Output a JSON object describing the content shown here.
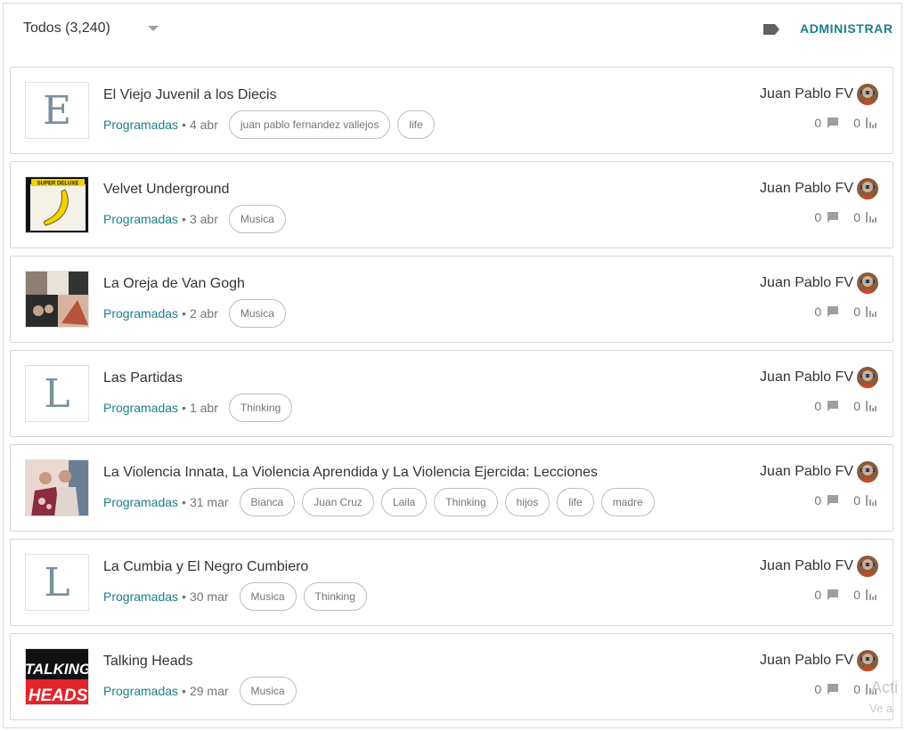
{
  "header": {
    "filter_label": "Todos (3,240)",
    "manage_label": "ADMINISTRAR",
    "label_icon": "label-tag-icon"
  },
  "posts": [
    {
      "title": "El Viejo Juvenil a los Diecis",
      "status": "Programadas",
      "date": "4 abr",
      "tags": [
        "juan pablo fernandez vallejos",
        "life"
      ],
      "author": "Juan Pablo FV",
      "comments": "0",
      "views": "0",
      "thumb_letter": "E"
    },
    {
      "title": "Velvet Underground",
      "status": "Programadas",
      "date": "3 abr",
      "tags": [
        "Musica"
      ],
      "author": "Juan Pablo FV",
      "comments": "0",
      "views": "0",
      "thumb_letter": "",
      "thumb_caption": "SUPER DELUXE"
    },
    {
      "title": "La Oreja de Van Gogh",
      "status": "Programadas",
      "date": "2 abr",
      "tags": [
        "Musica"
      ],
      "author": "Juan Pablo FV",
      "comments": "0",
      "views": "0",
      "thumb_letter": ""
    },
    {
      "title": "Las Partidas",
      "status": "Programadas",
      "date": "1 abr",
      "tags": [
        "Thinking"
      ],
      "author": "Juan Pablo FV",
      "comments": "0",
      "views": "0",
      "thumb_letter": "L"
    },
    {
      "title": "La Violencia Innata, La Violencia Aprendida y La Violencia Ejercida: Lecciones",
      "status": "Programadas",
      "date": "31 mar",
      "tags": [
        "Bianca",
        "Juan Cruz",
        "Laila",
        "Thinking",
        "hijos",
        "life",
        "madre"
      ],
      "author": "Juan Pablo FV",
      "comments": "0",
      "views": "0",
      "thumb_letter": ""
    },
    {
      "title": "La Cumbia y El Negro Cumbiero",
      "status": "Programadas",
      "date": "30 mar",
      "tags": [
        "Musica",
        "Thinking"
      ],
      "author": "Juan Pablo FV",
      "comments": "0",
      "views": "0",
      "thumb_letter": "L"
    },
    {
      "title": "Talking Heads",
      "status": "Programadas",
      "date": "29 mar",
      "tags": [
        "Musica"
      ],
      "author": "Juan Pablo FV",
      "comments": "0",
      "views": "0",
      "thumb_letter": "",
      "thumb_caption_1": "TALKING",
      "thumb_caption_2": "HEADS"
    }
  ],
  "overlay": {
    "activate_text": "Acti",
    "activate_sub": "Ve a"
  },
  "colors": {
    "accent": "#1a7f8a",
    "muted": "#757575",
    "tag_border": "#bdbdbd"
  }
}
